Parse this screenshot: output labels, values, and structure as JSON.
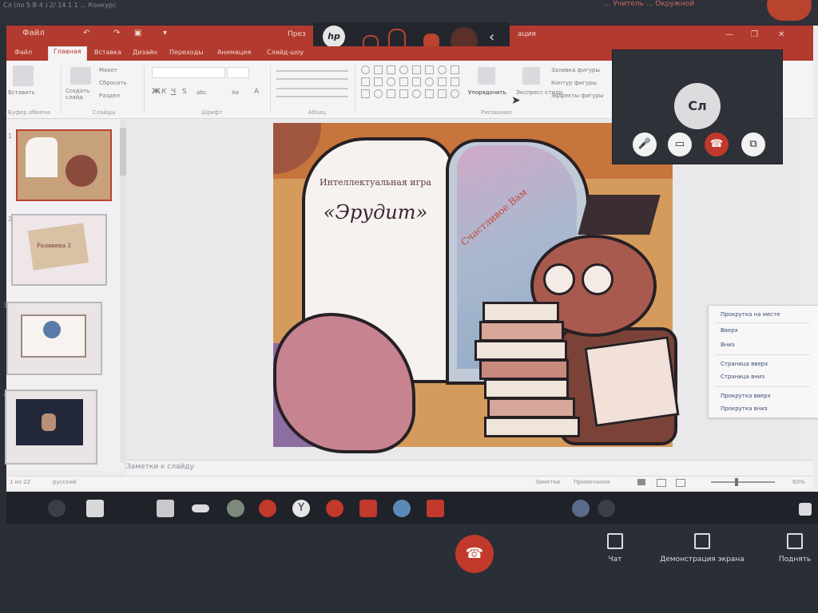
{
  "meeting_top": {
    "small_text": "Сл (по 5 В 4 ) 2/ 14 1 1 ... Конкурс",
    "right_text": "... Учитель ... Окружной"
  },
  "window": {
    "title": "През",
    "title_right": "ация",
    "quick_access": [
      "Файл",
      "↶",
      "↷",
      "▣",
      "▾"
    ],
    "controls": [
      "—",
      "❐",
      "✕"
    ]
  },
  "camera_toolbar": {
    "brand": "hp"
  },
  "ribbon": {
    "tabs": [
      "Файл",
      "Главная",
      "Вставка",
      "Дизайн",
      "Переходы",
      "Анимация",
      "Слайд-шоу"
    ],
    "active_tab": "Главная",
    "clipboard": {
      "paste": "Вставить",
      "group": "Буфер обмена"
    },
    "slides": {
      "new_slide": "Создать слайд",
      "layout": "Макет",
      "reset": "Сбросить",
      "section": "Раздел",
      "group": "Слайды"
    },
    "font": {
      "bold": "Ж",
      "italic": "К",
      "underline": "Ч",
      "strike": "S",
      "abc": "abc",
      "aa": "Aa",
      "a": "A",
      "group": "Шрифт"
    },
    "paragraph": {
      "group": "Абзац"
    },
    "drawing": {
      "arrange": "Упорядочить",
      "express": "Экспресс-стили",
      "fill": "Заливка фигуры",
      "outline": "Контур фигуры",
      "effects": "Эффекты фигуры",
      "group": "Рисование"
    }
  },
  "slides_panel": {
    "numbers": [
      "1",
      "2",
      "3",
      "4"
    ],
    "thumb2_caption": "Разминка 3"
  },
  "slide": {
    "subtitle": "Интеллектуальная игра",
    "title": "«Эрудит»",
    "book_banner": "Счастливое Вам"
  },
  "notes": {
    "placeholder": "Заметки к слайду"
  },
  "statusbar": {
    "slide_info": "1 из 22",
    "language": "русский",
    "notes": "Заметки",
    "comments": "Примечания",
    "zoom": "60%"
  },
  "call_window": {
    "initials": "Сл",
    "buttons": [
      "mic-icon",
      "camera-icon",
      "hangup-icon",
      "screen-share-icon"
    ]
  },
  "context_menu": {
    "items": [
      "Прокрутка на месте",
      "Вверх",
      "Вниз",
      "Страница вверх",
      "Страница вниз",
      "Прокрутка вверх",
      "Прокрутка вниз"
    ]
  },
  "meeting_controls": {
    "chat": "Чат",
    "share": "Демонстрация экрана",
    "raise": "Поднять"
  },
  "colors": {
    "accent": "#b23a2e",
    "end_call": "#c0392b",
    "background": "#2a2e36"
  }
}
